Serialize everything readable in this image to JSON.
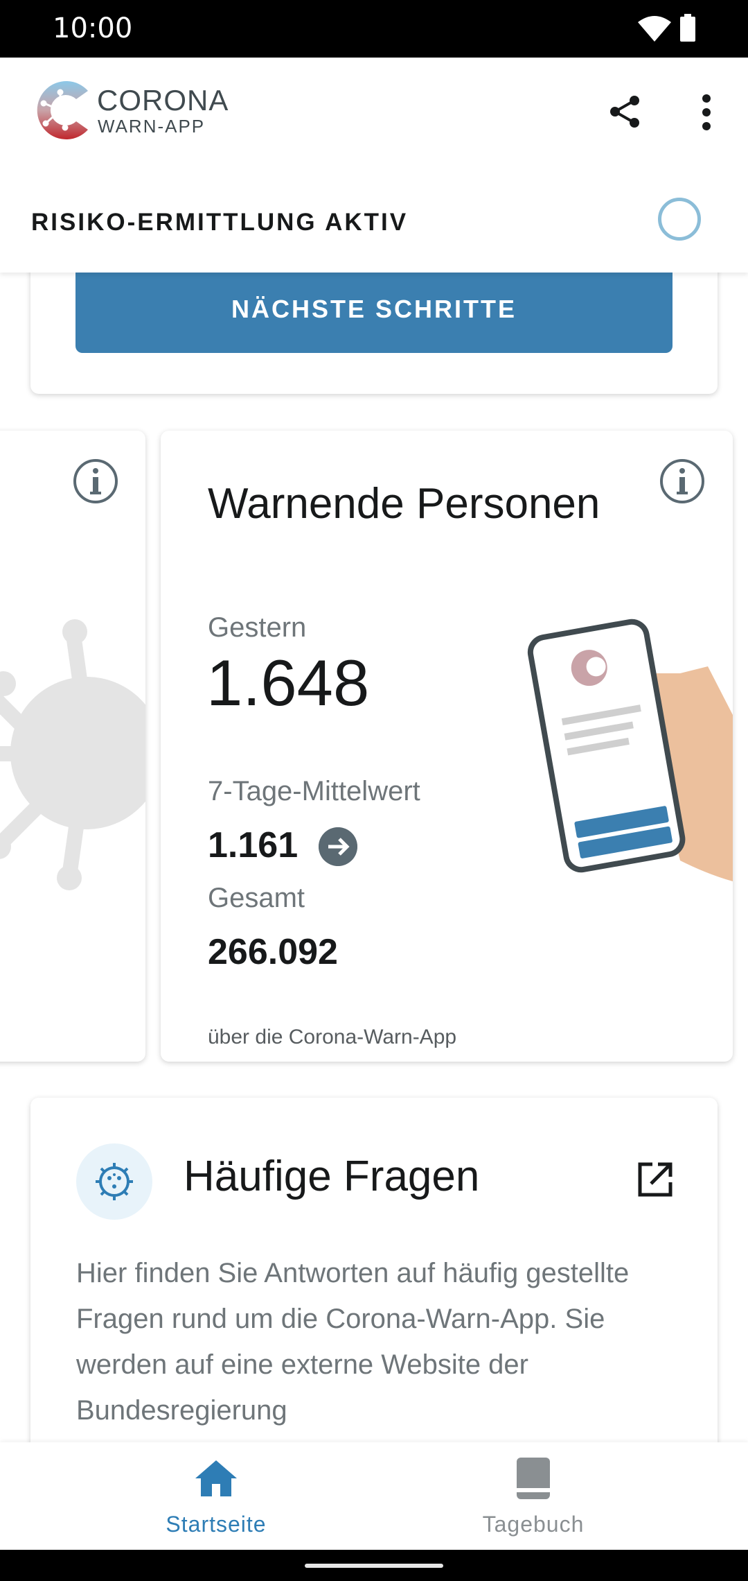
{
  "status_bar": {
    "time": "10:00"
  },
  "header": {
    "logo_title": "CORONA",
    "logo_subtitle": "WARN-APP",
    "risk_label": "RISIKO-ERMITTLUNG AKTIV"
  },
  "risk_card": {
    "next_steps_label": "NÄCHSTE SCHRITTE"
  },
  "stats_card": {
    "title": "Warnende Personen",
    "yesterday_label": "Gestern",
    "yesterday_value": "1.648",
    "average_label": "7-Tage-Mittelwert",
    "average_value": "1.161",
    "average_trend": "arrow-right-icon",
    "total_label": "Gesamt",
    "total_value": "266.092",
    "footnote": "über die Corona-Warn-App"
  },
  "faq_card": {
    "title": "Häufige Fragen",
    "body": "Hier finden Sie Antworten auf häufig gestellte Fragen rund um die Corona-Warn-App. Sie werden auf eine externe Website der Bundesregierung"
  },
  "bottom_nav": {
    "items": [
      {
        "label": "Startseite",
        "icon": "home-icon",
        "active": true
      },
      {
        "label": "Tagebuch",
        "icon": "book-icon",
        "active": false
      }
    ]
  },
  "colors": {
    "primary": "#3b7fb0",
    "nav_active": "#2e7db5",
    "spinner": "#8bbdd8",
    "text_secondary": "#6e7579"
  }
}
